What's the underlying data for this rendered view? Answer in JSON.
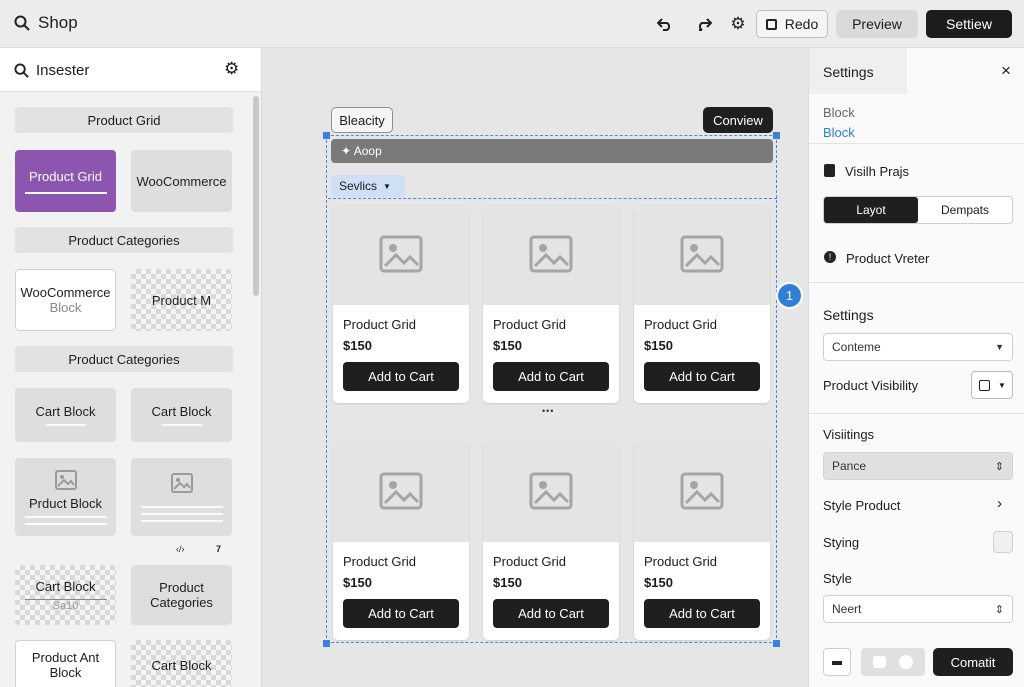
{
  "header": {
    "title": "Shop",
    "redo_label": "Redo",
    "preview_label": "Preview",
    "settings_label": "Settiew"
  },
  "inserter": {
    "title": "Insester",
    "categories": [
      "Product Grid",
      "Product Categories",
      "Product Categories"
    ],
    "tiles": {
      "product_grid": "Product Grid",
      "woocommerce": "WooCommerce",
      "woocommerce_block_1": "WooCommerce",
      "woocommerce_block_2": "Block",
      "product_m": "Product M",
      "cart_block_1": "Cart Block",
      "cart_block_2": "Cart Block",
      "prduct_block": "Prduct Block",
      "cart_block_3": "Cart Block",
      "cart_block_3_sub": "Sa10",
      "product_categories_1": "Product",
      "product_categories_2": "Categories",
      "product_ant_1": "Product Ant",
      "product_ant_2": "Block",
      "cart_block_4": "Cart Block"
    },
    "mini_icons": [
      "‹/›",
      "7"
    ]
  },
  "canvas": {
    "bleacity_label": "Bleacity",
    "conview_label": "Conview",
    "loop_label": "✦ Aoop",
    "services_label": "Sevlics",
    "cards": [
      {
        "name": "Product Grid",
        "price": "$150",
        "button": "Add to Cart"
      },
      {
        "name": "Product Grid",
        "price": "$150",
        "button": "Add to Cart"
      },
      {
        "name": "Product Grid",
        "price": "$150",
        "button": "Add to Cart"
      },
      {
        "name": "Product Grid",
        "price": "$150",
        "button": "Add to Cart"
      },
      {
        "name": "Product Grid",
        "price": "$150",
        "button": "Add to Cart"
      },
      {
        "name": "Product Grid",
        "price": "$150",
        "button": "Add to Cart"
      }
    ],
    "ellipsis": "•••",
    "badge": "1"
  },
  "settings": {
    "title": "Settings",
    "block_label": "Block",
    "block_link": "Block",
    "visible_label": "Visilh Prajs",
    "tab_layout": "Layot",
    "tab_dempats": "Dempats",
    "product_vreter": "Product Vreter",
    "settings_heading": "Settings",
    "conteme_value": "Conteme",
    "product_visibility": "Product Visibility",
    "visiitings": "Visiitings",
    "pance_value": "Pance",
    "style_product": "Style Product",
    "stying": "Stying",
    "style": "Style",
    "neert_value": "Neert",
    "compatit_label": "Comatit"
  },
  "colors": {
    "accent_purple": "#8b55b0",
    "primary_dark": "#1f1f1f",
    "link_blue": "#2f7fd6",
    "selection_blue": "#3c7fe0"
  }
}
